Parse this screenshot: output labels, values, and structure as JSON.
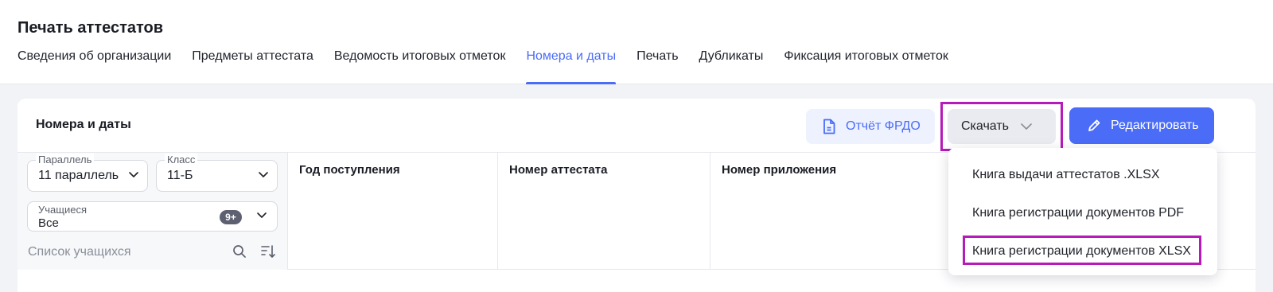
{
  "page": {
    "title": "Печать аттестатов"
  },
  "tabs": [
    {
      "label": "Сведения об организации",
      "active": false
    },
    {
      "label": "Предметы аттестата",
      "active": false
    },
    {
      "label": "Ведомость итоговых отметок",
      "active": false
    },
    {
      "label": "Номера и даты",
      "active": true
    },
    {
      "label": "Печать",
      "active": false
    },
    {
      "label": "Дубликаты",
      "active": false
    },
    {
      "label": "Фиксация итоговых отметок",
      "active": false
    }
  ],
  "card": {
    "title": "Номера и даты",
    "report_button": "Отчёт ФРДО",
    "download_button": "Скачать",
    "edit_button": "Редактировать"
  },
  "filters": {
    "parallel": {
      "label": "Параллель",
      "value": "11 параллель"
    },
    "class": {
      "label": "Класс",
      "value": "11-Б"
    },
    "students": {
      "label": "Учащиеся",
      "value": "Все",
      "badge": "9+"
    },
    "search_placeholder": "Список учащихся"
  },
  "table": {
    "columns": [
      "Год поступления",
      "Номер аттестата",
      "Номер приложения"
    ]
  },
  "download_menu": {
    "items": [
      "Книга выдачи аттестатов .XLSX",
      "Книга регистрации документов PDF",
      "Книга регистрации документов XLSX"
    ]
  },
  "colors": {
    "accent": "#4a6cf7",
    "highlight": "#b51bb8"
  }
}
